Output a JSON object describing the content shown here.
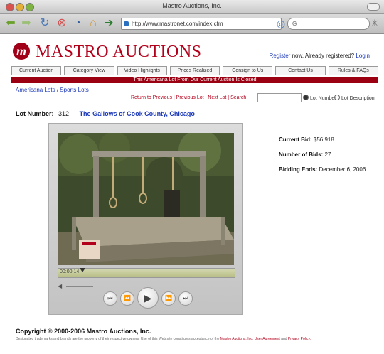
{
  "window": {
    "title": "Mastro Auctions, Inc."
  },
  "toolbar": {
    "url": "http://www.mastronet.com/index.cfm",
    "search_value": "G"
  },
  "site": {
    "brand_letter": "m",
    "brand_name": "MASTRO AUCTIONS",
    "register": "Register",
    "register_suffix": "now. Already registered?",
    "login": "Login"
  },
  "nav": {
    "items": [
      {
        "label": "Current Auction"
      },
      {
        "label": "Category View"
      },
      {
        "label": "Video Highlights"
      },
      {
        "label": "Prices Realized"
      },
      {
        "label": "Consign to Us"
      },
      {
        "label": "Contact Us"
      },
      {
        "label": "Rules & FAQs"
      }
    ]
  },
  "notice": {
    "text": "This Americana Lot From Our Current Auction Is Closed"
  },
  "breadcrumb": {
    "americana": "Americana Lots",
    "sep": "/",
    "sports": "Sports Lots"
  },
  "pager": {
    "text": "Return to Previous | Previous Lot | Next Lot | Search"
  },
  "search_options": {
    "by_lot": "Lot Number",
    "by_desc": "Lot Description"
  },
  "lot": {
    "label": "Lot Number:",
    "number": "312",
    "title": "The Gallows of Cook County, Chicago"
  },
  "player": {
    "timecode": "00:00:14",
    "progress": 0.12
  },
  "bid": {
    "current_label": "Current Bid:",
    "current_value": "$56,918",
    "count_label": "Number of Bids:",
    "count_value": "27",
    "ends_label": "Bidding Ends:",
    "ends_value": "December 6, 2006"
  },
  "footer": {
    "copyright": "Copyright © 2000-2006 Mastro Auctions, Inc.",
    "fineprint": "Designated trademarks and brands are the property of their respective owners. Use of this Web site constitutes acceptance of the",
    "link1": "Mastro Auctions, Inc. User Agreement",
    "and": "and",
    "link2": "Privacy Policy."
  }
}
